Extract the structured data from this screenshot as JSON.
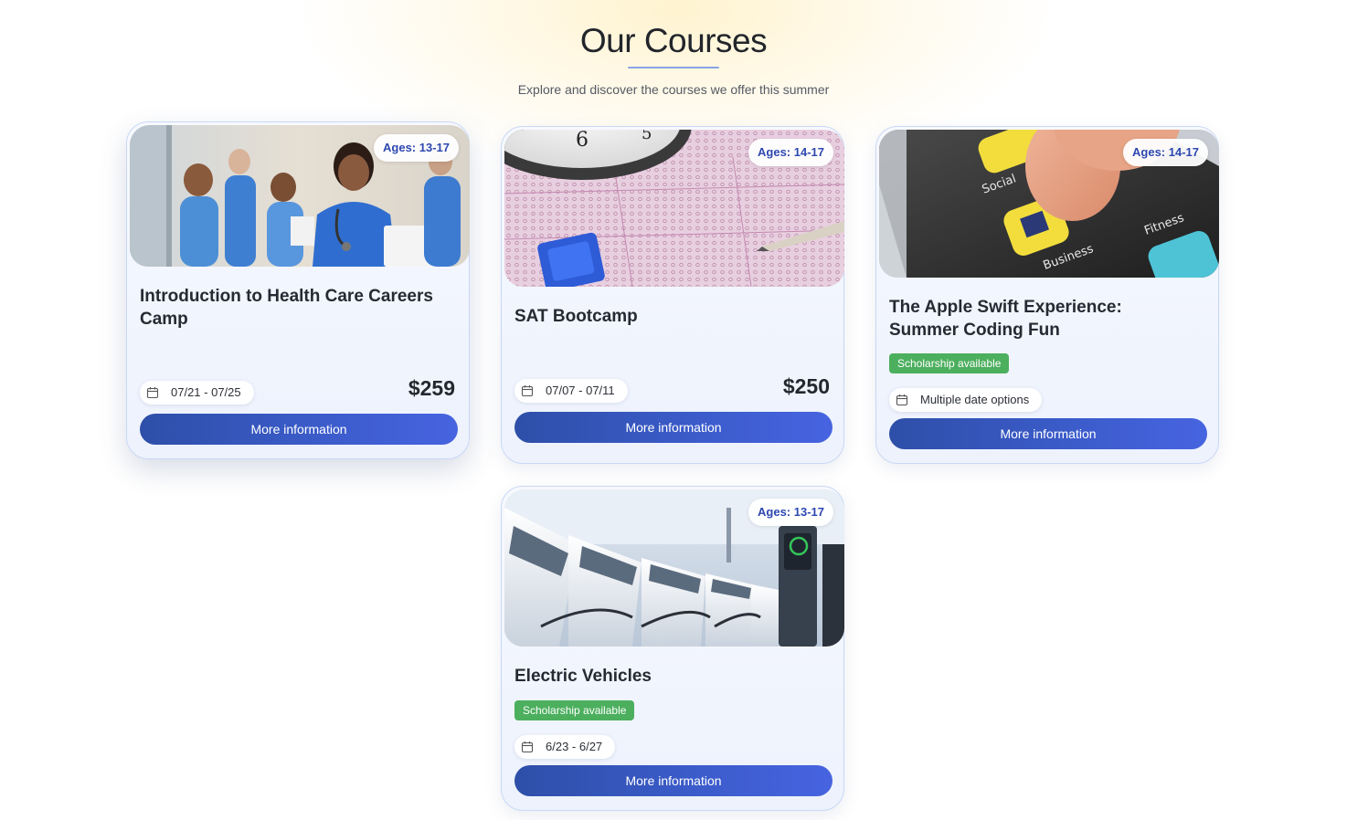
{
  "header": {
    "title": "Our Courses",
    "subtitle": "Explore and discover the courses we offer this summer"
  },
  "colors": {
    "accent": "#3c5ccc",
    "badge_text": "#2d48b0",
    "scholarship": "#4caf5e",
    "card_border": "#c9d8f5"
  },
  "courses": [
    {
      "title": "Introduction to Health Care Careers Camp",
      "ages": "Ages: 13-17",
      "dates": "07/21 - 07/25",
      "price": "$259",
      "button": "More information",
      "image": "healthcare-students-photo",
      "calendar_icon": "calendar-icon"
    },
    {
      "title": "SAT Bootcamp",
      "ages": "Ages: 14-17",
      "dates": "07/07 - 07/11",
      "price": "$250",
      "button": "More information",
      "image": "sat-answer-sheet-photo",
      "calendar_icon": "calendar-icon"
    },
    {
      "title": "The Apple Swift Experience: Summer Coding Fun",
      "ages": "Ages: 14-17",
      "scholarship": "Scholarship available",
      "dates": "Multiple date options",
      "button": "More information",
      "image": "smartphone-apps-photo",
      "calendar_icon": "calendar-icon"
    },
    {
      "title": "Electric Vehicles",
      "ages": "Ages: 13-17",
      "scholarship": "Scholarship available",
      "dates": "6/23 - 6/27",
      "button": "More information",
      "image": "ev-charging-photo",
      "calendar_icon": "calendar-icon"
    }
  ]
}
